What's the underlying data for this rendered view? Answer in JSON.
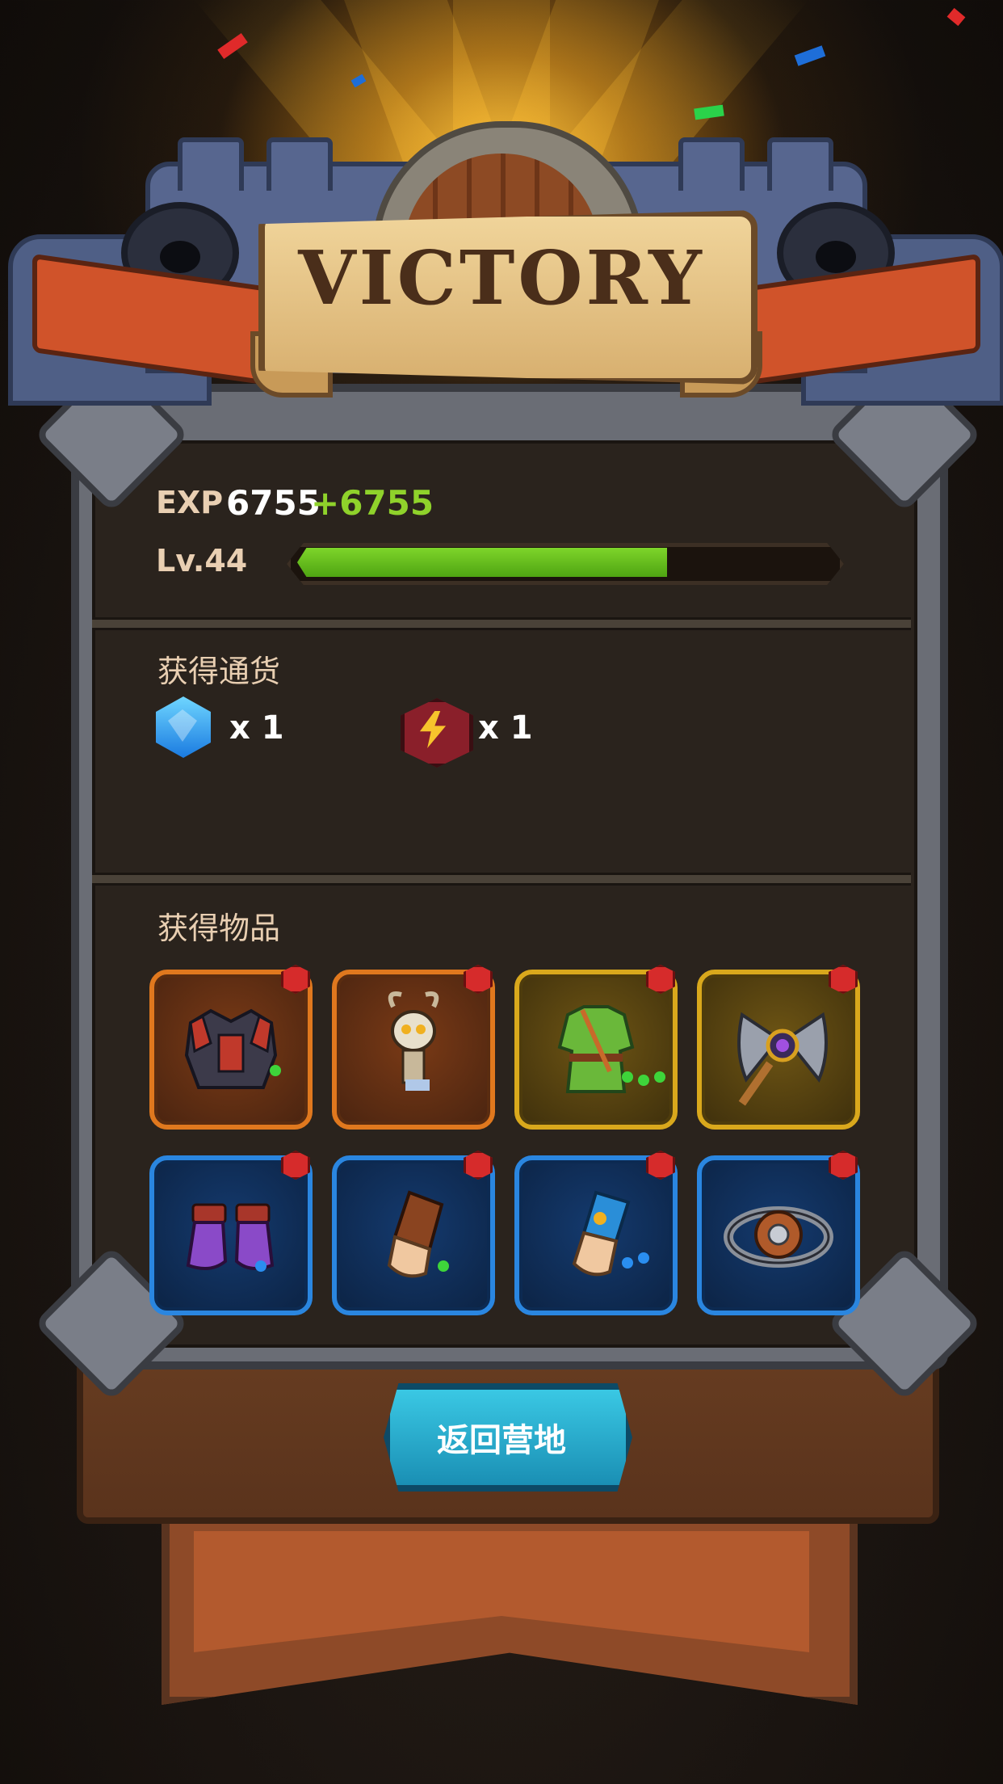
{
  "header": {
    "title": "VICTORY"
  },
  "exp": {
    "label": "EXP",
    "value": "6755",
    "gain": "+6755"
  },
  "level": {
    "label": "Lv.44",
    "progress": 0.7
  },
  "currency": {
    "title": "获得通货",
    "items": [
      {
        "icon": "blue-gem-icon",
        "quantity": "x 1"
      },
      {
        "icon": "energy-bolt-icon",
        "quantity": "x 1"
      }
    ]
  },
  "items": {
    "title": "获得物品",
    "list": [
      {
        "name": "armor-chestplate",
        "rarity": "orange"
      },
      {
        "name": "skeleton-pet",
        "rarity": "orange"
      },
      {
        "name": "green-tunic",
        "rarity": "yellow"
      },
      {
        "name": "battle-axe",
        "rarity": "yellow"
      },
      {
        "name": "purple-boots",
        "rarity": "blue"
      },
      {
        "name": "leather-bracer",
        "rarity": "blue"
      },
      {
        "name": "blue-glove",
        "rarity": "blue"
      },
      {
        "name": "metal-ring",
        "rarity": "blue"
      }
    ]
  },
  "return_button": {
    "label": "返回营地"
  },
  "colors": {
    "exp_gain": "#8fd22b",
    "label": "#e9cfb2",
    "button": "#2aaccf"
  }
}
